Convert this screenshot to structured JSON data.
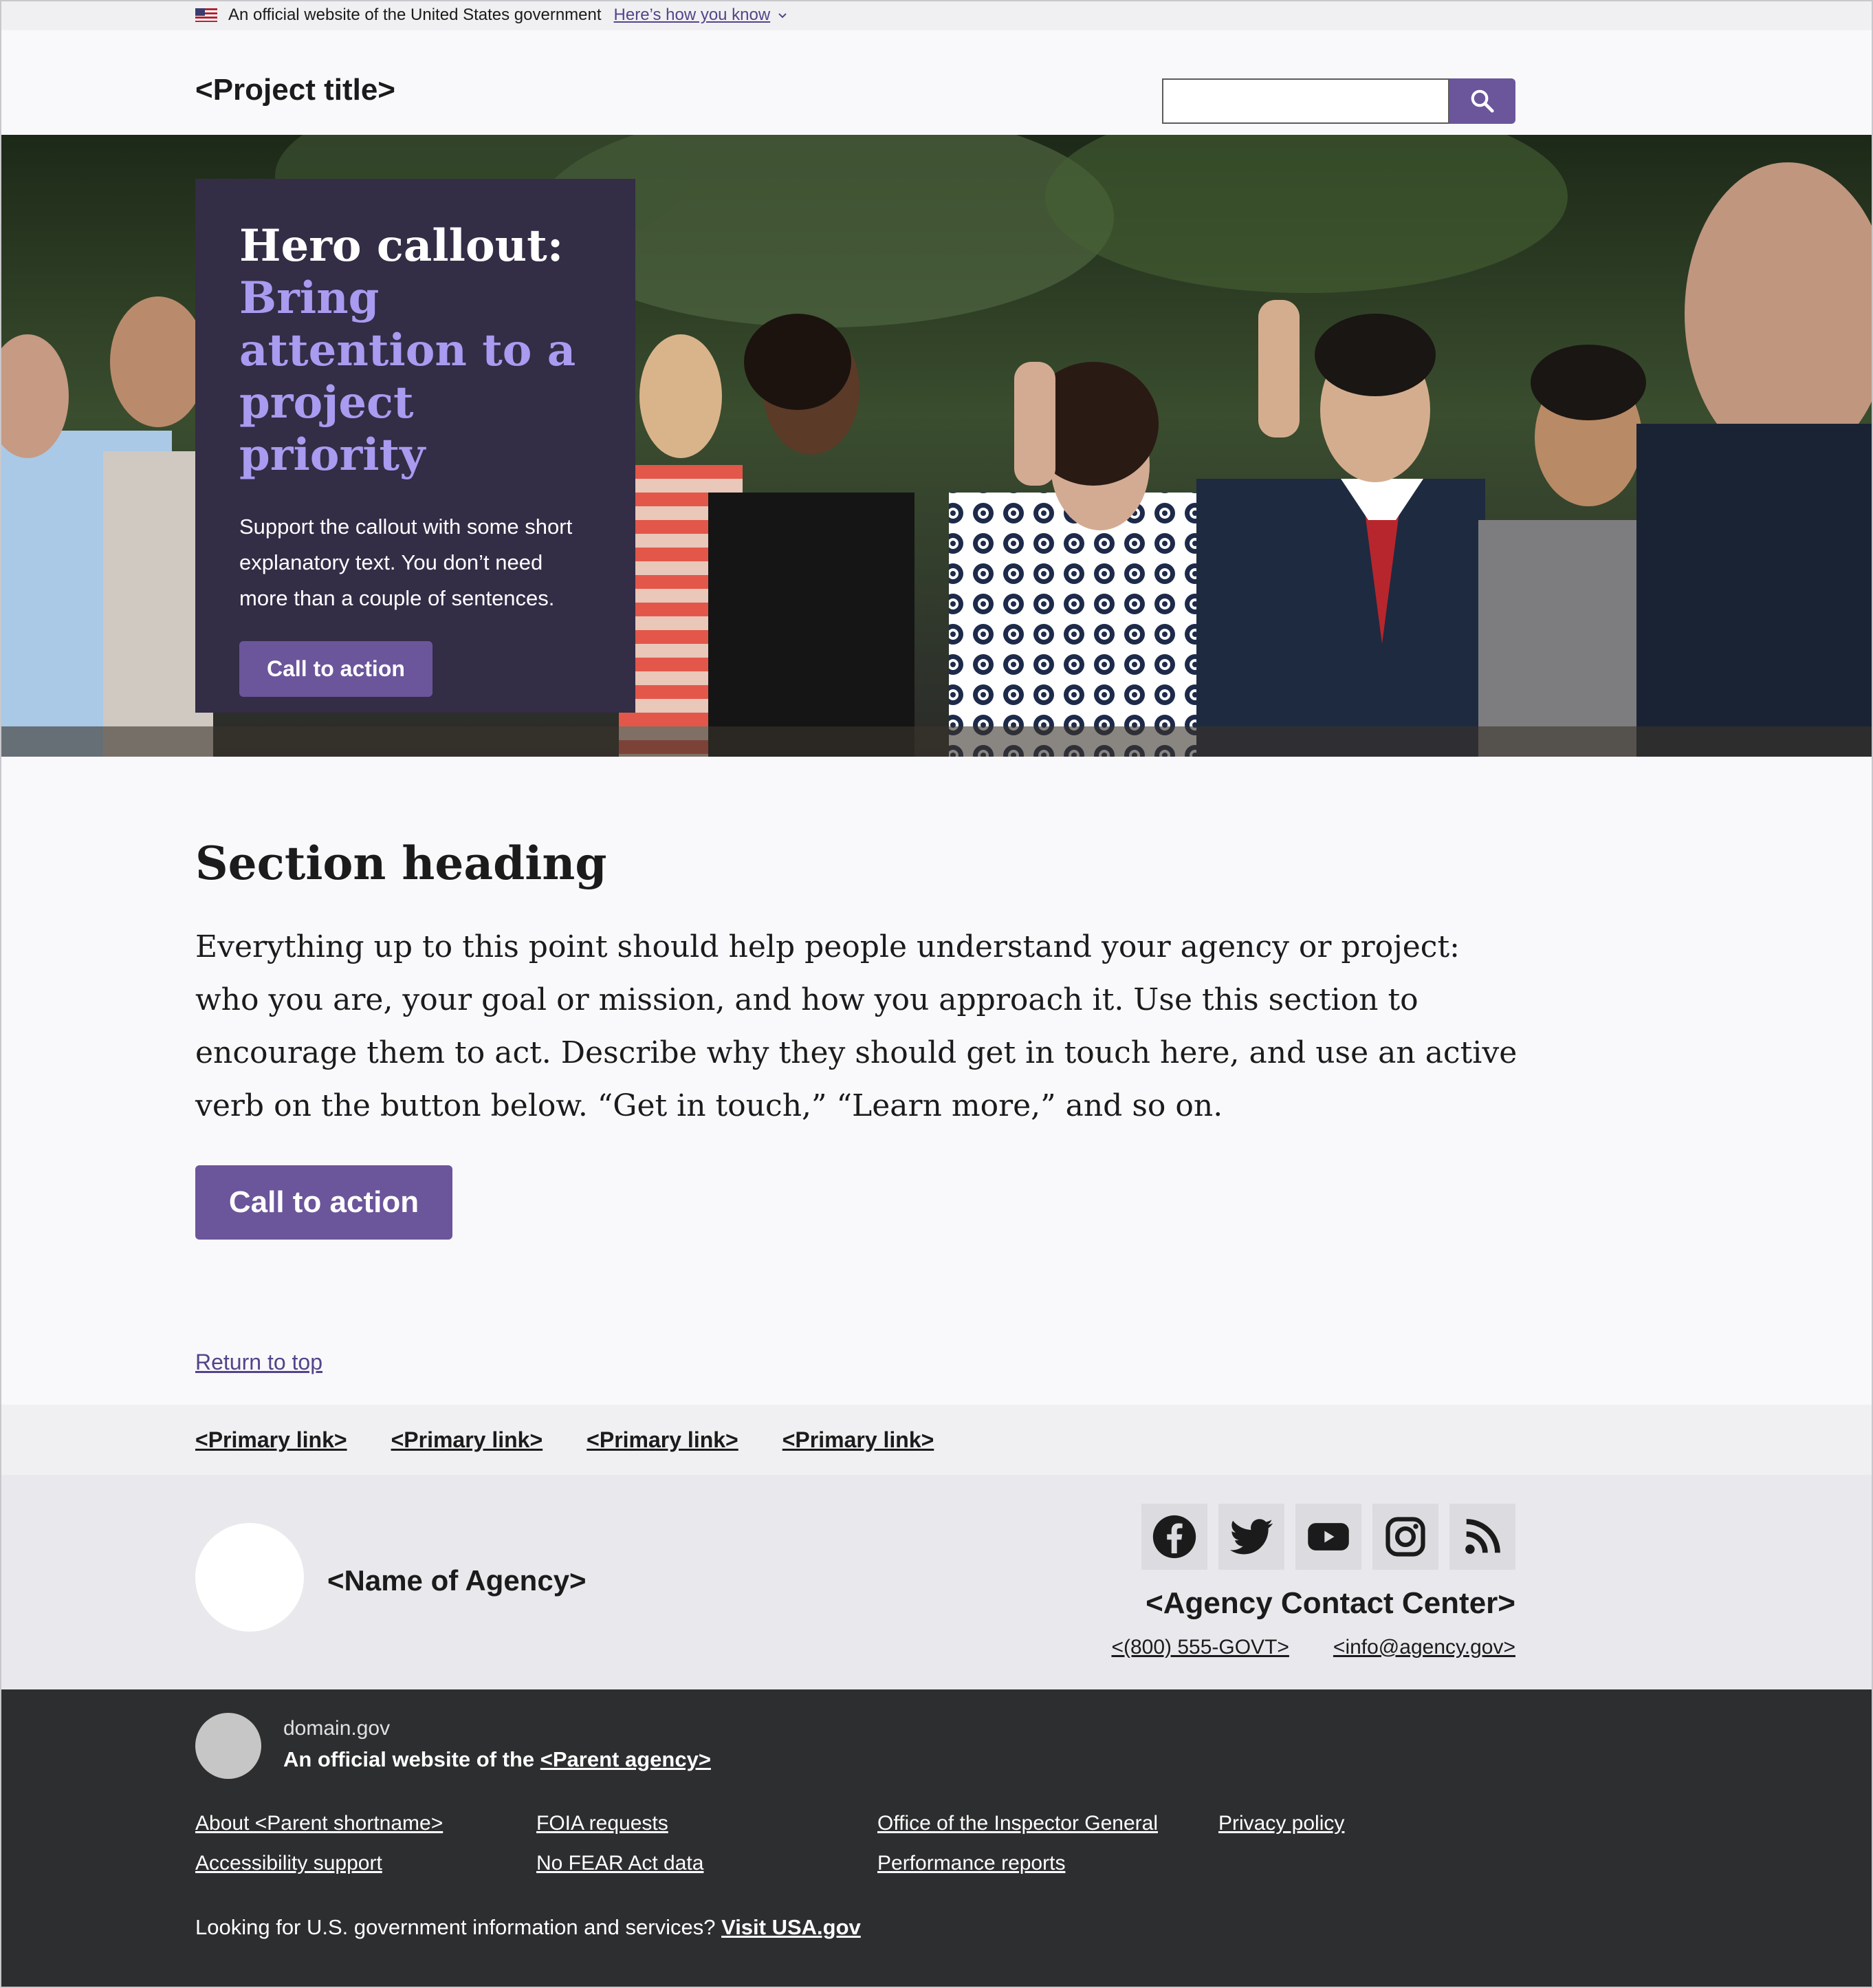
{
  "gov_banner": {
    "text": "An official website of the United States government",
    "link": "Here’s how you know"
  },
  "header": {
    "project_title": "<Project title>",
    "search_placeholder": ""
  },
  "hero": {
    "heading": "Hero callout:",
    "heading_accent": "Bring attention to a project priority",
    "body": "Support the callout with some short explanatory text. You don’t need more than a couple of sentences.",
    "cta": "Call to action"
  },
  "section": {
    "heading": "Section heading",
    "body": "Everything up to this point should help people understand your agency or project: who you are, your goal or mission, and how you approach it. Use this section to encourage them to act. Describe why they should get in touch here, and use an active verb on the button below. “Get in touch,” “Learn more,” and so on.",
    "cta": "Call to action"
  },
  "return_to_top": "Return to top",
  "primary_links": [
    "<Primary link>",
    "<Primary link>",
    "<Primary link>",
    "<Primary link>"
  ],
  "footer": {
    "agency_name": "<Name of Agency>",
    "social_icons": [
      "facebook-icon",
      "twitter-icon",
      "youtube-icon",
      "instagram-icon",
      "rss-icon"
    ],
    "contact_heading": "<Agency Contact Center>",
    "phone": "<(800) 555-GOVT>",
    "email": "<info@agency.gov>"
  },
  "identifier": {
    "domain": "domain.gov",
    "official_prefix": "An official website of the",
    "parent_agency": "<Parent agency>",
    "links": [
      "About <Parent shortname>",
      "FOIA requests",
      "Office of the Inspector General",
      "Privacy policy",
      "Accessibility support",
      "No FEAR Act data",
      "Performance reports"
    ],
    "usagov_text": "Looking for U.S. government information and services?",
    "usagov_link": "Visit USA.gov"
  },
  "colors": {
    "primary": "#6b559b",
    "callout_bg": "#332d46",
    "accent_text": "#a99bf0",
    "identifier_bg": "#2d2e2f"
  }
}
